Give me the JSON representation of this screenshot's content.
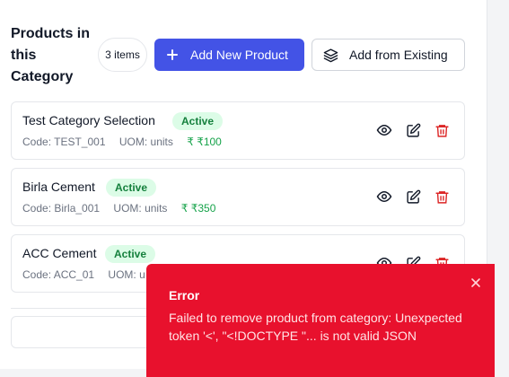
{
  "section": {
    "title": "Products in this Category",
    "count_badge": "3 items"
  },
  "toolbar": {
    "add_new_label": "Add New Product",
    "add_existing_label": "Add from Existing"
  },
  "products": [
    {
      "name": "Test Category Selection",
      "status": "Active",
      "code": "Code: TEST_001",
      "uom": "UOM: units",
      "price": "₹ ₹100"
    },
    {
      "name": "Birla Cement",
      "status": "Active",
      "code": "Code: Birla_001",
      "uom": "UOM: units",
      "price": "₹ ₹350"
    },
    {
      "name": "ACC Cement",
      "status": "Active",
      "code": "Code: ACC_01",
      "uom": "UOM: u"
    }
  ],
  "toast": {
    "title": "Error",
    "message": "Failed to remove product from category: Unexpected token '<', \"<!DOCTYPE \"... is not valid JSON"
  },
  "colors": {
    "primary": "#4353e6",
    "active_bg": "#dcfce7",
    "active_text": "#15803d",
    "price": "#16a34a",
    "delete": "#dc2626",
    "toast_bg": "#e8112d"
  }
}
